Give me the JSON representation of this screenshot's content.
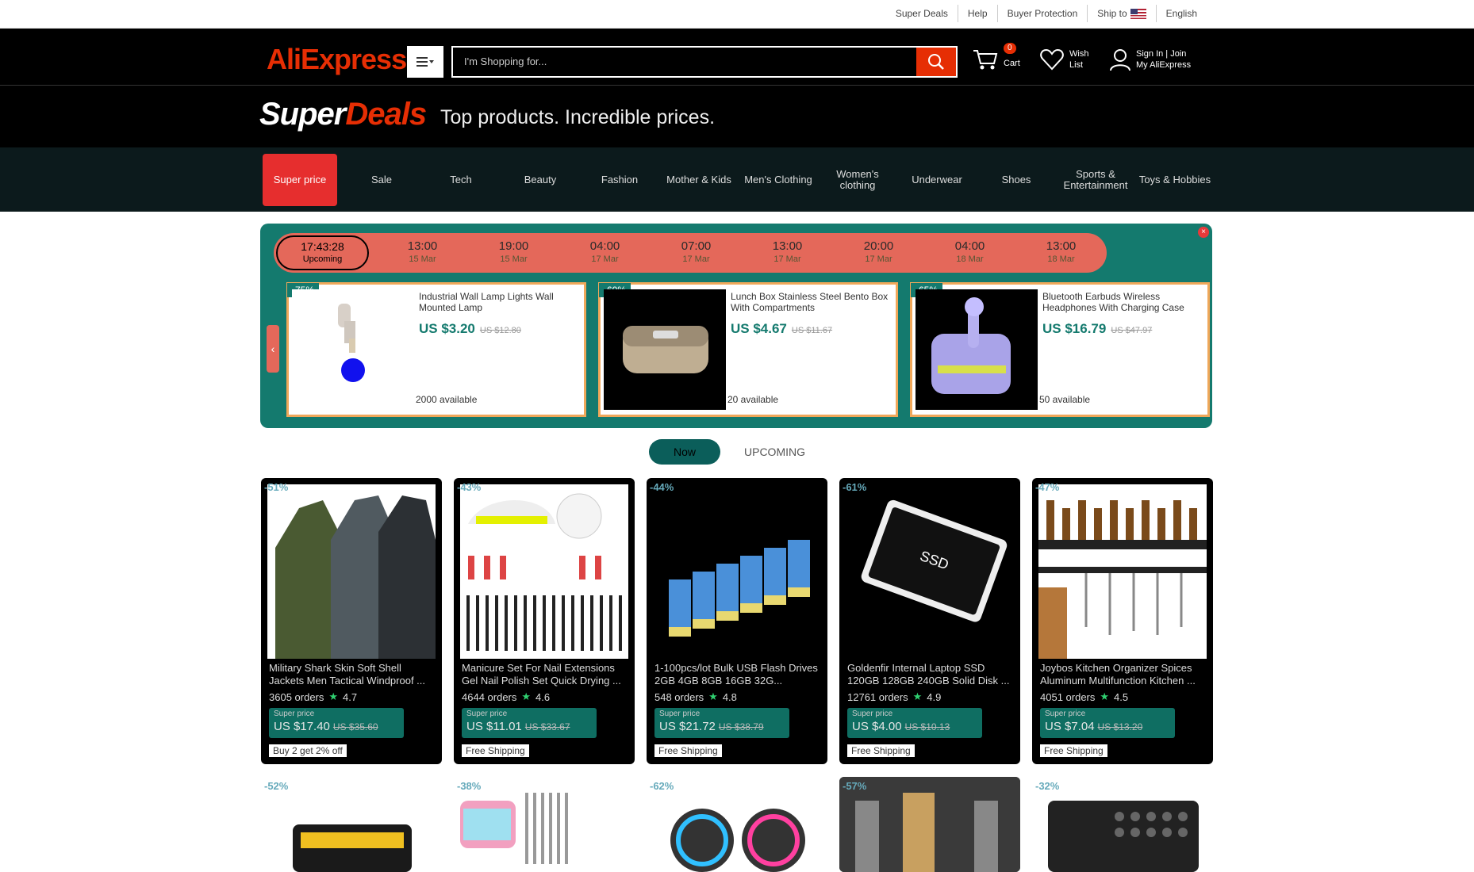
{
  "utility": {
    "items": [
      "Super Deals",
      "Help",
      "Buyer Protection",
      "Ship to",
      "English"
    ]
  },
  "header": {
    "logo": "AliExpress",
    "search_placeholder": "I'm Shopping for...",
    "cart_count": "0",
    "cart_label": "Cart",
    "wish_label_1": "Wish",
    "wish_label_2": "List",
    "account_1": "Sign In | Join",
    "account_2": "My AliExpress"
  },
  "banner": {
    "logo_a": "Super",
    "logo_b": "Deals",
    "tagline": "Top products. Incredible prices."
  },
  "categories": [
    "Super price",
    "Sale",
    "Tech",
    "Beauty",
    "Fashion",
    "Mother & Kids",
    "Men's Clothing",
    "Women's clothing",
    "Underwear",
    "Shoes",
    "Sports & Entertainment",
    "Toys & Hobbies"
  ],
  "flash": {
    "current": {
      "time": "17:43:28",
      "label": "Upcoming"
    },
    "slots": [
      {
        "time": "13:00",
        "date": "15 Mar"
      },
      {
        "time": "19:00",
        "date": "15 Mar"
      },
      {
        "time": "04:00",
        "date": "17 Mar"
      },
      {
        "time": "07:00",
        "date": "17 Mar"
      },
      {
        "time": "13:00",
        "date": "17 Mar"
      },
      {
        "time": "20:00",
        "date": "17 Mar"
      },
      {
        "time": "04:00",
        "date": "18 Mar"
      },
      {
        "time": "13:00",
        "date": "18 Mar"
      }
    ],
    "cards": [
      {
        "discount": "-75%",
        "title": "Industrial Wall Lamp Lights Wall Mounted Lamp",
        "price": "US $3.20",
        "old": "US $12.80",
        "avail": "2000 available"
      },
      {
        "discount": "-60%",
        "title": "Lunch Box Stainless Steel Bento Box With Compartments",
        "price": "US $4.67",
        "old": "US $11.67",
        "avail": "20 available"
      },
      {
        "discount": "-65%",
        "title": "Bluetooth Earbuds Wireless Headphones With Charging Case",
        "price": "US $16.79",
        "old": "US $47.97",
        "avail": "50 available"
      }
    ]
  },
  "tabs": {
    "now": "Now",
    "upcoming": "UPCOMING"
  },
  "products": [
    {
      "discount": "-51%",
      "title": "Military Shark Skin Soft Shell Jackets Men Tactical Windproof ...",
      "orders": "3605 orders",
      "rating": "4.7",
      "label": "Super price",
      "price": "US $17.40",
      "old": "US $35.60",
      "ship": "Buy 2 get 2% off"
    },
    {
      "discount": "-43%",
      "title": "Manicure Set For Nail Extensions Gel Nail Polish Set Quick Drying ...",
      "orders": "4644 orders",
      "rating": "4.6",
      "label": "Super price",
      "price": "US $11.01",
      "old": "US $33.67",
      "ship": "Free Shipping"
    },
    {
      "discount": "-44%",
      "title": "1-100pcs/lot Bulk USB Flash Drives 2GB 4GB 8GB 16GB 32G...",
      "orders": "548 orders",
      "rating": "4.8",
      "label": "Super price",
      "price": "US $21.72",
      "old": "US $38.79",
      "ship": "Free Shipping"
    },
    {
      "discount": "-61%",
      "title": "Goldenfir Internal Laptop SSD 120GB 128GB 240GB Solid Disk ...",
      "orders": "12761 orders",
      "rating": "4.9",
      "label": "Super price",
      "price": "US $4.00",
      "old": "US $10.13",
      "ship": "Free Shipping"
    },
    {
      "discount": "-47%",
      "title": "Joybos Kitchen Organizer Spices Aluminum Multifunction Kitchen ...",
      "orders": "4051 orders",
      "rating": "4.5",
      "label": "Super price",
      "price": "US $7.04",
      "old": "US $13.20",
      "ship": "Free Shipping"
    }
  ],
  "products_row2": [
    {
      "discount": "-52%"
    },
    {
      "discount": "-38%"
    },
    {
      "discount": "-62%"
    },
    {
      "discount": "-57%"
    },
    {
      "discount": "-32%"
    }
  ],
  "colors": {
    "accent": "#e62e04",
    "teal": "#147a6e",
    "timeline": "#e4685a"
  }
}
